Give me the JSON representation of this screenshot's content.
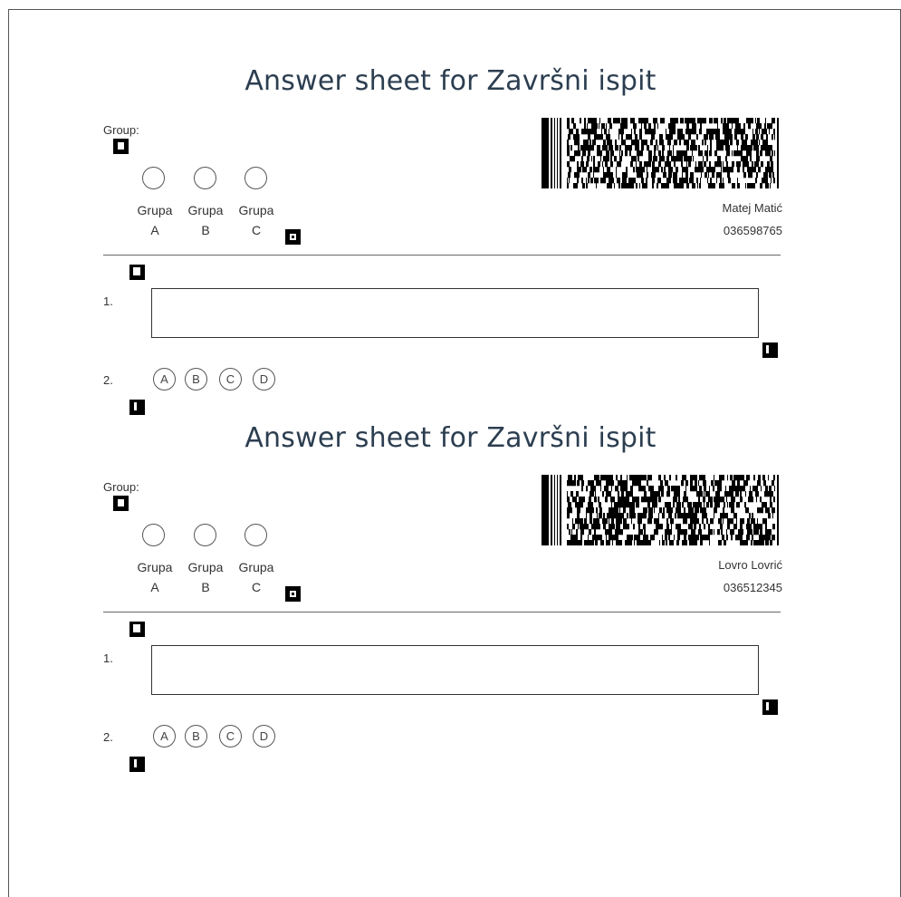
{
  "sheets": [
    {
      "title": "Answer sheet for Završni ispit",
      "group_label": "Group:",
      "groups": [
        {
          "line1": "Grupa",
          "line2": "A"
        },
        {
          "line1": "Grupa",
          "line2": "B"
        },
        {
          "line1": "Grupa",
          "line2": "C"
        }
      ],
      "student_name": "Matej Matić",
      "student_id": "036598765",
      "questions": [
        {
          "number": "1.",
          "type": "text"
        },
        {
          "number": "2.",
          "type": "choice",
          "options": [
            "A",
            "B",
            "C",
            "D"
          ]
        }
      ]
    },
    {
      "title": "Answer sheet for Završni ispit",
      "group_label": "Group:",
      "groups": [
        {
          "line1": "Grupa",
          "line2": "A"
        },
        {
          "line1": "Grupa",
          "line2": "B"
        },
        {
          "line1": "Grupa",
          "line2": "C"
        }
      ],
      "student_name": "Lovro Lovrić",
      "student_id": "036512345",
      "questions": [
        {
          "number": "1.",
          "type": "text"
        },
        {
          "number": "2.",
          "type": "choice",
          "options": [
            "A",
            "B",
            "C",
            "D"
          ]
        }
      ]
    }
  ]
}
